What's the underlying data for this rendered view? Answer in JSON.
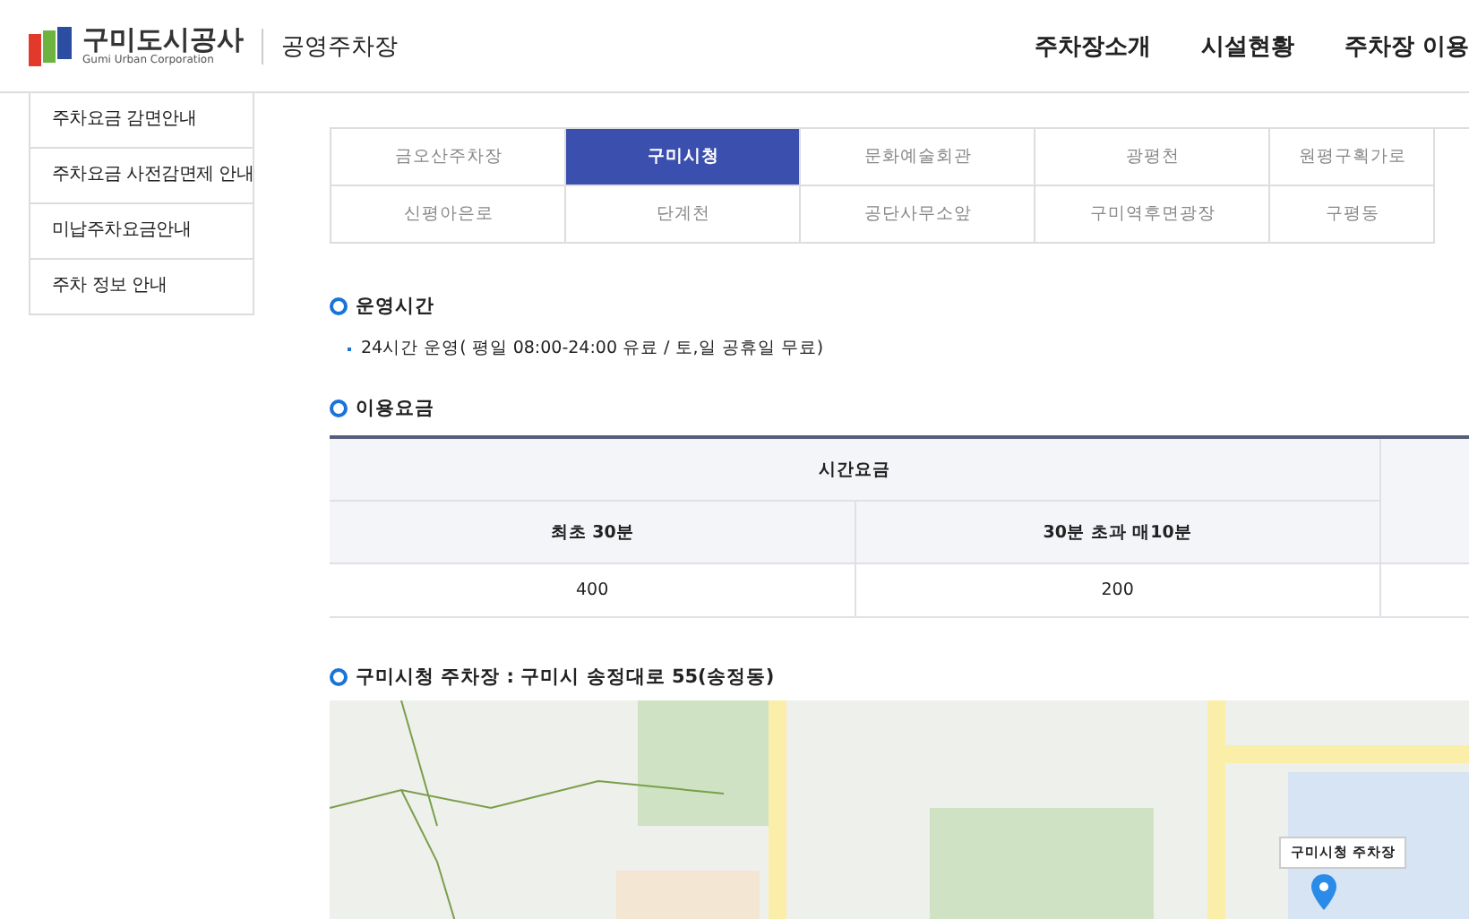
{
  "header": {
    "logo_name": "구미도시공사",
    "logo_subtitle": "Gumi Urban Corporation",
    "site_title": "공영주차장",
    "nav": [
      "주차장소개",
      "시설현황",
      "주차장 이용"
    ]
  },
  "sidebar": {
    "items": [
      {
        "label": "주차요금 감면안내",
        "selected": false
      },
      {
        "label": "주차요금 사전감면제 안내",
        "selected": false
      },
      {
        "label": "미납주차요금안내",
        "selected": false
      },
      {
        "label": "주차 정보 안내",
        "selected": false
      }
    ]
  },
  "tabs": [
    {
      "label": "금오산주차장",
      "selected": false
    },
    {
      "label": "구미시청",
      "selected": true
    },
    {
      "label": "문화예술회관",
      "selected": false
    },
    {
      "label": "광평천",
      "selected": false
    },
    {
      "label": "원평구획가로",
      "selected": false
    },
    {
      "label": "신평아은로",
      "selected": false
    },
    {
      "label": "단계천",
      "selected": false
    },
    {
      "label": "공단사무소앞",
      "selected": false
    },
    {
      "label": "구미역후면광장",
      "selected": false
    },
    {
      "label": "구평동",
      "selected": false
    }
  ],
  "hours": {
    "heading": "운영시간",
    "items": [
      "24시간 운영( 평일 08:00-24:00 유료 / 토,일 공휴일 무료)"
    ]
  },
  "fees": {
    "heading": "이용요금",
    "group_header": "시간요금",
    "columns": [
      "최초 30분",
      "30분 초과 매10분"
    ],
    "rows": [
      [
        "400",
        "200"
      ]
    ]
  },
  "map": {
    "heading": "구미시청 주차장 : 구미시 송정대로 55(송정동)",
    "marker_label": "구미시청 주차장"
  }
}
